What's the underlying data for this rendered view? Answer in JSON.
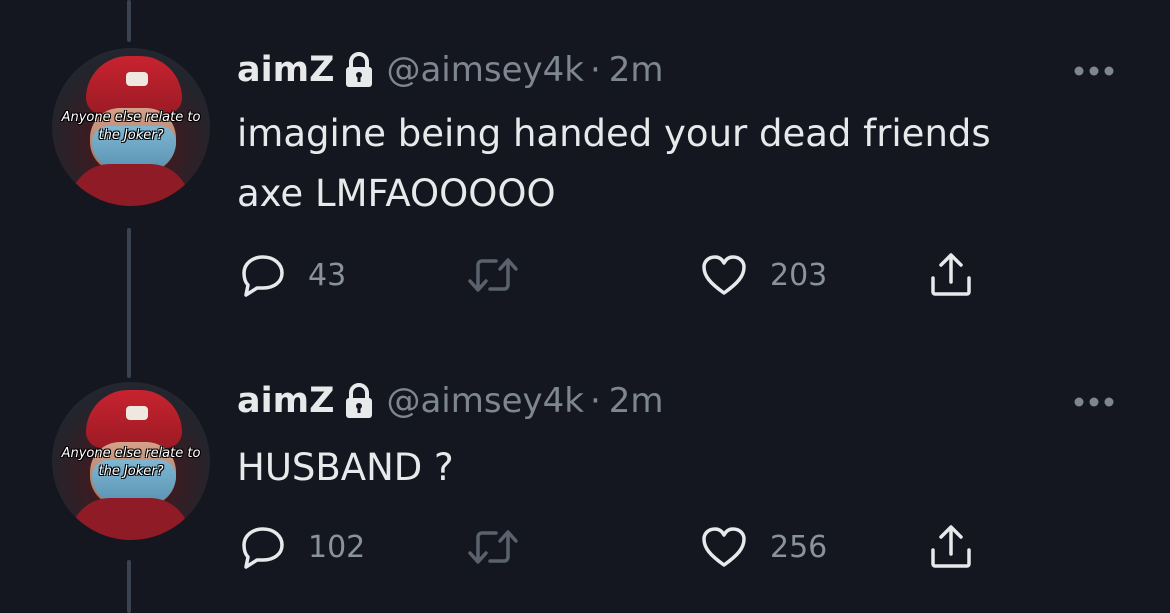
{
  "tweets": [
    {
      "avatar_caption_line1": "Anyone else relate to",
      "avatar_caption_line2": "the Joker?",
      "display_name": "aimZ",
      "handle": "@aimsey4k",
      "separator": "·",
      "time": "2m",
      "text_line1": "imagine being handed your dead friends",
      "text_line2": "axe LMFAOOOOO",
      "reply_count": "43",
      "retweet_count": "",
      "like_count": "203"
    },
    {
      "avatar_caption_line1": "Anyone else relate to",
      "avatar_caption_line2": "the Joker?",
      "display_name": "aimZ",
      "handle": "@aimsey4k",
      "separator": "·",
      "time": "2m",
      "text_line1": "HUSBAND ?",
      "text_line2": "",
      "reply_count": "102",
      "retweet_count": "",
      "like_count": "256"
    }
  ],
  "icons": {
    "lock": "lock-icon",
    "more": "more-horizontal-icon",
    "reply": "reply-bubble-icon",
    "retweet": "retweet-icon",
    "like": "heart-icon",
    "share": "share-icon"
  },
  "colors": {
    "background": "#14171f",
    "primary_text": "#e7e9ea",
    "secondary_text": "#7e8791",
    "thread_line": "#3b4350"
  }
}
